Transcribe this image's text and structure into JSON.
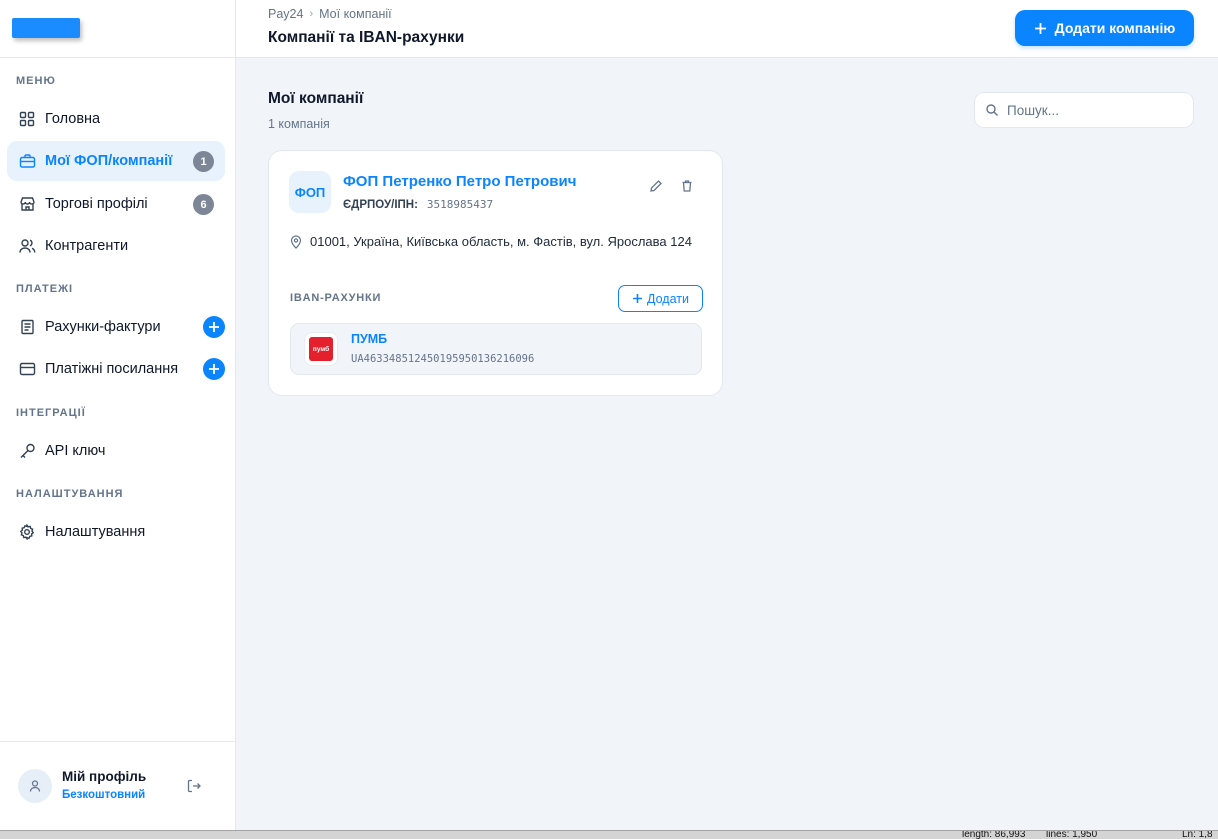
{
  "sidebar": {
    "logo": "logo",
    "sections": {
      "menu": "МЕНЮ",
      "payments": "ПЛАТЕЖІ",
      "integrations": "ІНТЕГРАЦІЇ",
      "settings": "НАЛАШТУВАННЯ"
    },
    "items": [
      {
        "label": "Головна",
        "icon": "grid-icon"
      },
      {
        "label": "Мої ФОП/компанії",
        "icon": "briefcase-icon",
        "badge": "1",
        "active": true
      },
      {
        "label": "Торгові профілі",
        "icon": "store-icon",
        "badge": "6"
      },
      {
        "label": "Контрагенти",
        "icon": "users-icon"
      },
      {
        "label": "Рахунки-фактури",
        "icon": "document-icon"
      },
      {
        "label": "Платіжні посилання",
        "icon": "card-icon"
      },
      {
        "label": "API ключ",
        "icon": "key-icon"
      },
      {
        "label": "Налаштування",
        "icon": "gear-icon"
      }
    ],
    "profile": {
      "name": "Мій профіль",
      "plan": "Безкоштовний"
    }
  },
  "header": {
    "breadcrumb": [
      "Pay24",
      "Мої компанії"
    ],
    "title": "Компанії та IBAN-рахунки",
    "add_button": "Додати компанію"
  },
  "main": {
    "title": "Мої компанії",
    "subtitle": "1 компанія",
    "search_placeholder": "Пошук...",
    "companies": [
      {
        "avatar": "ФОП",
        "name": "ФОП Петренко Петро Петрович",
        "edrpou_label": "ЄДРПОУ/ІПН:",
        "edrpou": "3518985437",
        "address": "01001, Україна, Київська область, м. Фастів, вул. Ярослава 124",
        "iban_section_label": "IBAN-РАХУНКИ",
        "iban_add_label": "Додати",
        "ibans": [
          {
            "bank": "ПУМБ",
            "bank_logo_text": "пумб",
            "iban": "UA463348512450195950136216096"
          }
        ]
      }
    ]
  },
  "status_bar": {
    "length": "length: 86,993",
    "lines": "lines: 1,950",
    "ln": "Ln: 1,8"
  },
  "colors": {
    "accent": "#0a84ff",
    "sidebar_active_bg": "#e8f2fd",
    "badge": "#7c8696",
    "bank_logo": "#e4202d"
  }
}
